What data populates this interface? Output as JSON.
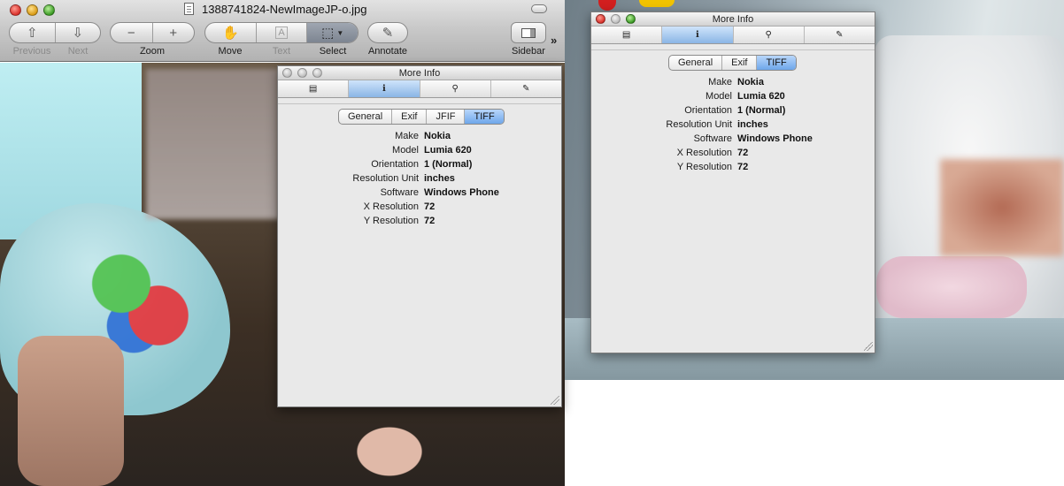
{
  "preview": {
    "title": "1388741824-NewImageJP-o.jpg",
    "toolbar": {
      "previous_label": "Previous",
      "next_label": "Next",
      "zoom_label": "Zoom",
      "zoom_out_glyph": "−",
      "zoom_in_glyph": "+",
      "move_label": "Move",
      "text_label": "Text",
      "select_label": "Select",
      "annotate_label": "Annotate",
      "sidebar_label": "Sidebar",
      "overflow_glyph": "»"
    }
  },
  "inspector": {
    "title": "More Info",
    "tabs": [
      {
        "icon": "document-icon",
        "glyph": "▤"
      },
      {
        "icon": "info-icon",
        "glyph": "ℹ"
      },
      {
        "icon": "magnifier-icon",
        "glyph": "⚲"
      },
      {
        "icon": "pencil-icon",
        "glyph": "✎"
      }
    ],
    "segments_left": [
      "General",
      "Exif",
      "JFIF",
      "TIFF"
    ],
    "segments_right": [
      "General",
      "Exif",
      "TIFF"
    ],
    "selected_segment": "TIFF",
    "fields": [
      {
        "key": "Make",
        "value": "Nokia"
      },
      {
        "key": "Model",
        "value": "Lumia 620"
      },
      {
        "key": "Orientation",
        "value": "1 (Normal)"
      },
      {
        "key": "Resolution Unit",
        "value": "inches"
      },
      {
        "key": "Software",
        "value": "Windows Phone"
      },
      {
        "key": "X Resolution",
        "value": "72"
      },
      {
        "key": "Y Resolution",
        "value": "72"
      }
    ]
  },
  "colors": {
    "selected_tab": "#8ab5e5",
    "panel_background": "#e9e9e9"
  }
}
